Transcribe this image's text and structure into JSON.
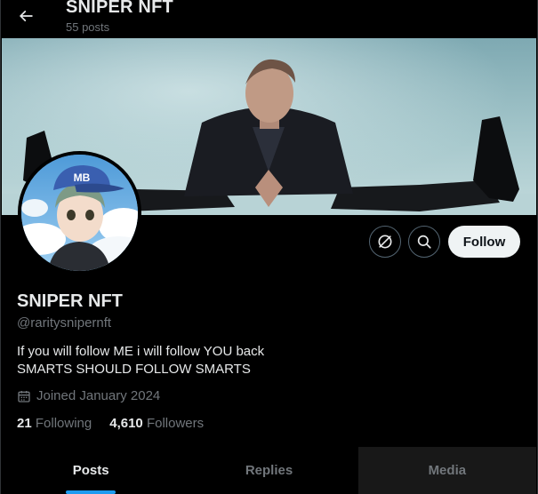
{
  "header": {
    "title": "SNIPER NFT",
    "post_count": "55 posts"
  },
  "actions": {
    "follow_label": "Follow"
  },
  "profile": {
    "name": "SNIPER NFT",
    "handle": "@raritysnipernft",
    "bio_lines": [
      "If you will follow ME i will follow YOU back",
      "SMARTS SHOULD FOLLOW SMARTS"
    ],
    "joined": "Joined January 2024",
    "following_count": "21",
    "following_label": "Following",
    "followers_count": "4,610",
    "followers_label": "Followers",
    "avatar_cap_text": "MB"
  },
  "tabs": [
    {
      "label": "Posts",
      "active": true
    },
    {
      "label": "Replies",
      "active": false
    },
    {
      "label": "Media",
      "active": false
    }
  ],
  "colors": {
    "background": "#000000",
    "text_primary": "#e7e9ea",
    "text_secondary": "#71767b",
    "accent": "#1d9bf0",
    "follow_bg": "#eff3f4"
  },
  "icons": [
    "back-arrow-icon",
    "grok-icon",
    "search-icon",
    "calendar-icon"
  ]
}
